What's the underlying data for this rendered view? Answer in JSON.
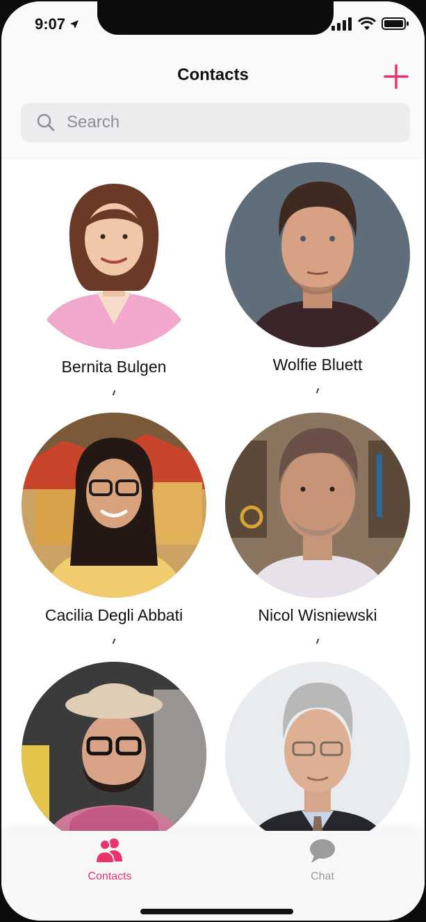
{
  "status_bar": {
    "time": "9:07"
  },
  "header": {
    "title": "Contacts"
  },
  "search": {
    "placeholder": "Search"
  },
  "contacts": [
    {
      "name": "Bernita Bulgen"
    },
    {
      "name": "Wolfie Bluett"
    },
    {
      "name": "Cacilia Degli Abbati"
    },
    {
      "name": "Nicol Wisniewski"
    },
    {
      "name": ""
    },
    {
      "name": ""
    }
  ],
  "tabs": [
    {
      "label": "Contacts",
      "icon": "users-icon",
      "active": true
    },
    {
      "label": "Chat",
      "icon": "chat-bubble-icon",
      "active": false
    }
  ],
  "colors": {
    "accent": "#e8336b",
    "inactive": "#9b9b9b",
    "search_bg": "#ececee"
  }
}
